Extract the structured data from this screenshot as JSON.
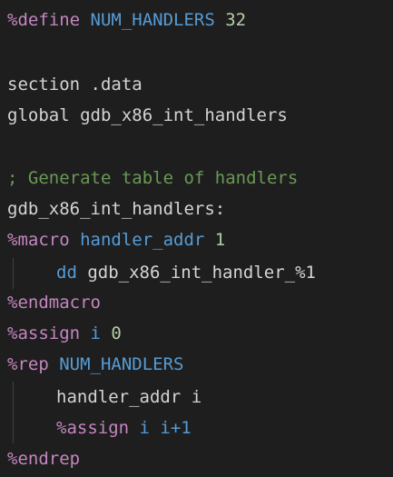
{
  "colors": {
    "background": "#1e1e1e",
    "default_text": "#d4d4d4",
    "directive": "#c586c0",
    "identifier": "#569cd6",
    "number": "#b5cea8",
    "comment": "#6a9955",
    "indent_guide": "#404040"
  },
  "code": {
    "line1": {
      "directive": "%define",
      "name": " NUM_HANDLERS",
      "value": " 32"
    },
    "line2": {
      "text": ""
    },
    "line3": {
      "text": "section .data"
    },
    "line4": {
      "text": "global gdb_x86_int_handlers"
    },
    "line5": {
      "text": ""
    },
    "line6": {
      "comment": "; Generate table of handlers"
    },
    "line7": {
      "text": "gdb_x86_int_handlers:"
    },
    "line8": {
      "directive": "%macro",
      "name": " handler_addr",
      "value": " 1"
    },
    "line9": {
      "text": "dd gdb_x86_int_handler_%1",
      "keyword": "dd",
      "rest": " gdb_x86_int_handler_%1"
    },
    "line10": {
      "directive": "%endmacro"
    },
    "line11": {
      "directive": "%assign",
      "name": " i",
      "value": " 0"
    },
    "line12": {
      "directive": "%rep",
      "name": " NUM_HANDLERS"
    },
    "line13": {
      "text": "handler_addr i"
    },
    "line14": {
      "directive": "%assign",
      "name": " i i+1"
    },
    "line15": {
      "directive": "%endrep"
    }
  }
}
